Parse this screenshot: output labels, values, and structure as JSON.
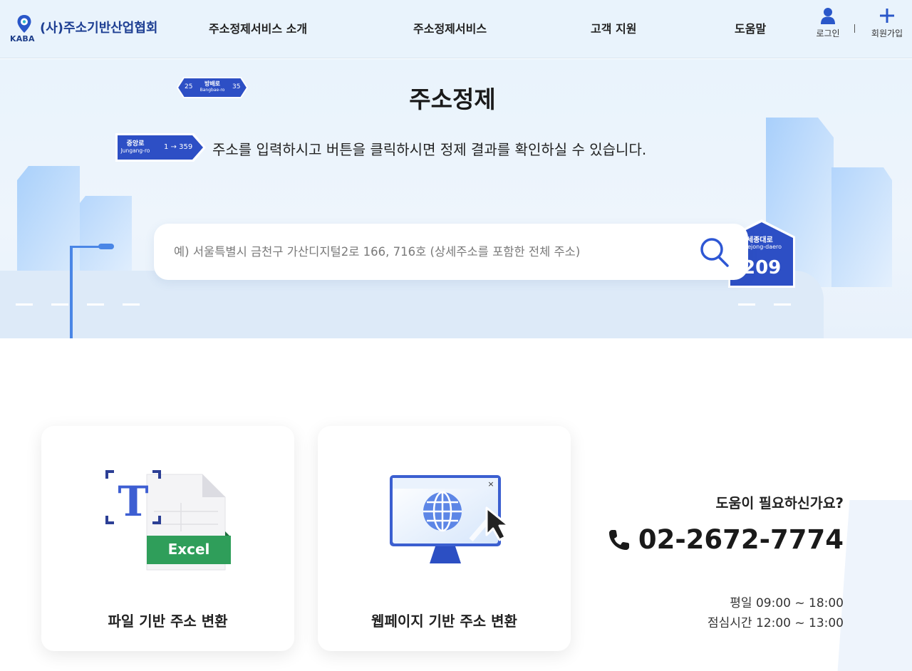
{
  "header": {
    "logo_text": "KABA",
    "org_name": "(사)주소기반산업협회",
    "nav": [
      "주소정제서비스 소개",
      "주소정제서비스",
      "고객 지원",
      "도움말"
    ],
    "login_label": "로그인",
    "signup_label": "회원가입",
    "separator": "|"
  },
  "hero": {
    "title": "주소정제",
    "subtitle": "주소를 입력하시고 버튼을 클릭하시면 정제 결과를 확인하실 수 있습니다.",
    "signs": {
      "bangbae": {
        "left_num": "25",
        "name": "방배로",
        "roman": "Bangbae-ro",
        "right_num": "35"
      },
      "jungang": {
        "name": "중앙로",
        "roman": "Jungang-ro",
        "range": "1 → 359"
      },
      "sejong": {
        "name": "세종대로",
        "roman": "Sejong-daero",
        "num": "209"
      }
    }
  },
  "search": {
    "placeholder": "예) 서울특별시 금천구 가산디지털2로 166, 716호 (상세주소를 포함한 전체 주소)",
    "value": ""
  },
  "cards": [
    {
      "label": "파일 기반 주소 변환",
      "icon": "excel-file-icon",
      "badge": "Excel"
    },
    {
      "label": "웹페이지 기반 주소 변환",
      "icon": "web-monitor-icon"
    }
  ],
  "help": {
    "question": "도움이 필요하신가요?",
    "phone": "02-2672-7774",
    "hours_weekday": "평일 09:00 ~ 18:00",
    "hours_lunch": "점심시간 12:00 ~ 13:00"
  },
  "colors": {
    "brand": "#1e3f93",
    "accent": "#3b5fd0",
    "sign_blue": "#2d4fc5",
    "excel_green": "#2f9e5a",
    "hero_bg": "#e9f3fc"
  }
}
